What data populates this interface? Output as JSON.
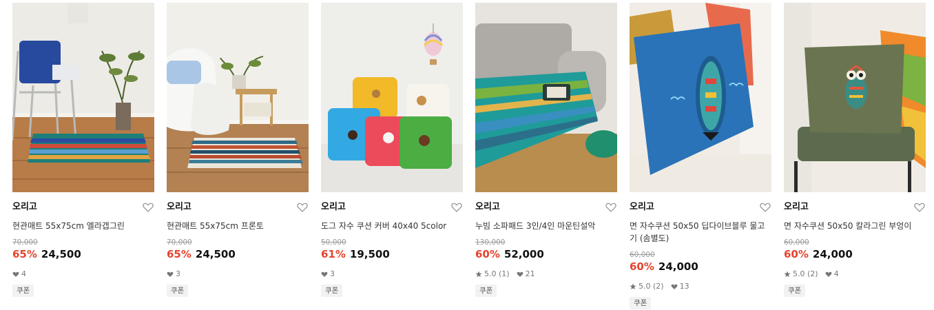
{
  "colors": {
    "discount": "#e4442f",
    "price": "#111111",
    "muted": "#9a9a9a"
  },
  "products": [
    {
      "brand": "오리고",
      "name": "현관매트 55x75cm 엘라갭그린",
      "original_price": "70,000",
      "discount": "65%",
      "price": "24,500",
      "likes": "4",
      "coupon": "쿠폰",
      "image_icon": "striped-doormat-chair-photo"
    },
    {
      "brand": "오리고",
      "name": "현관매트 55x75cm 프론토",
      "original_price": "70,000",
      "discount": "65%",
      "price": "24,500",
      "likes": "3",
      "coupon": "쿠폰",
      "image_icon": "striped-doormat-armchair-photo"
    },
    {
      "brand": "오리고",
      "name": "도그 자수 쿠션 커버 40x40 5color",
      "original_price": "50,000",
      "discount": "61%",
      "price": "19,500",
      "likes": "3",
      "coupon": "쿠폰",
      "image_icon": "dog-cushions-photo"
    },
    {
      "brand": "오리고",
      "name": "누빔 소파패드 3인/4인 마운틴설악",
      "original_price": "130,000",
      "discount": "60%",
      "price": "52,000",
      "rating": "5.0 (1)",
      "likes": "21",
      "coupon": "쿠폰",
      "image_icon": "sofa-pad-photo"
    },
    {
      "brand": "오리고",
      "name": "면 자수쿠션 50x50 딥다이브블루 물고기 (솜별도)",
      "original_price": "60,000",
      "discount": "60%",
      "price": "24,000",
      "rating": "5.0 (2)",
      "likes": "13",
      "coupon": "쿠폰",
      "image_icon": "blue-fish-cushion-photo"
    },
    {
      "brand": "오리고",
      "name": "면 자수쿠션 50x50 칼라그린 부엉이",
      "original_price": "60,000",
      "discount": "60%",
      "price": "24,000",
      "rating": "5.0 (2)",
      "likes": "4",
      "coupon": "쿠폰",
      "image_icon": "green-owl-cushion-photo"
    }
  ]
}
